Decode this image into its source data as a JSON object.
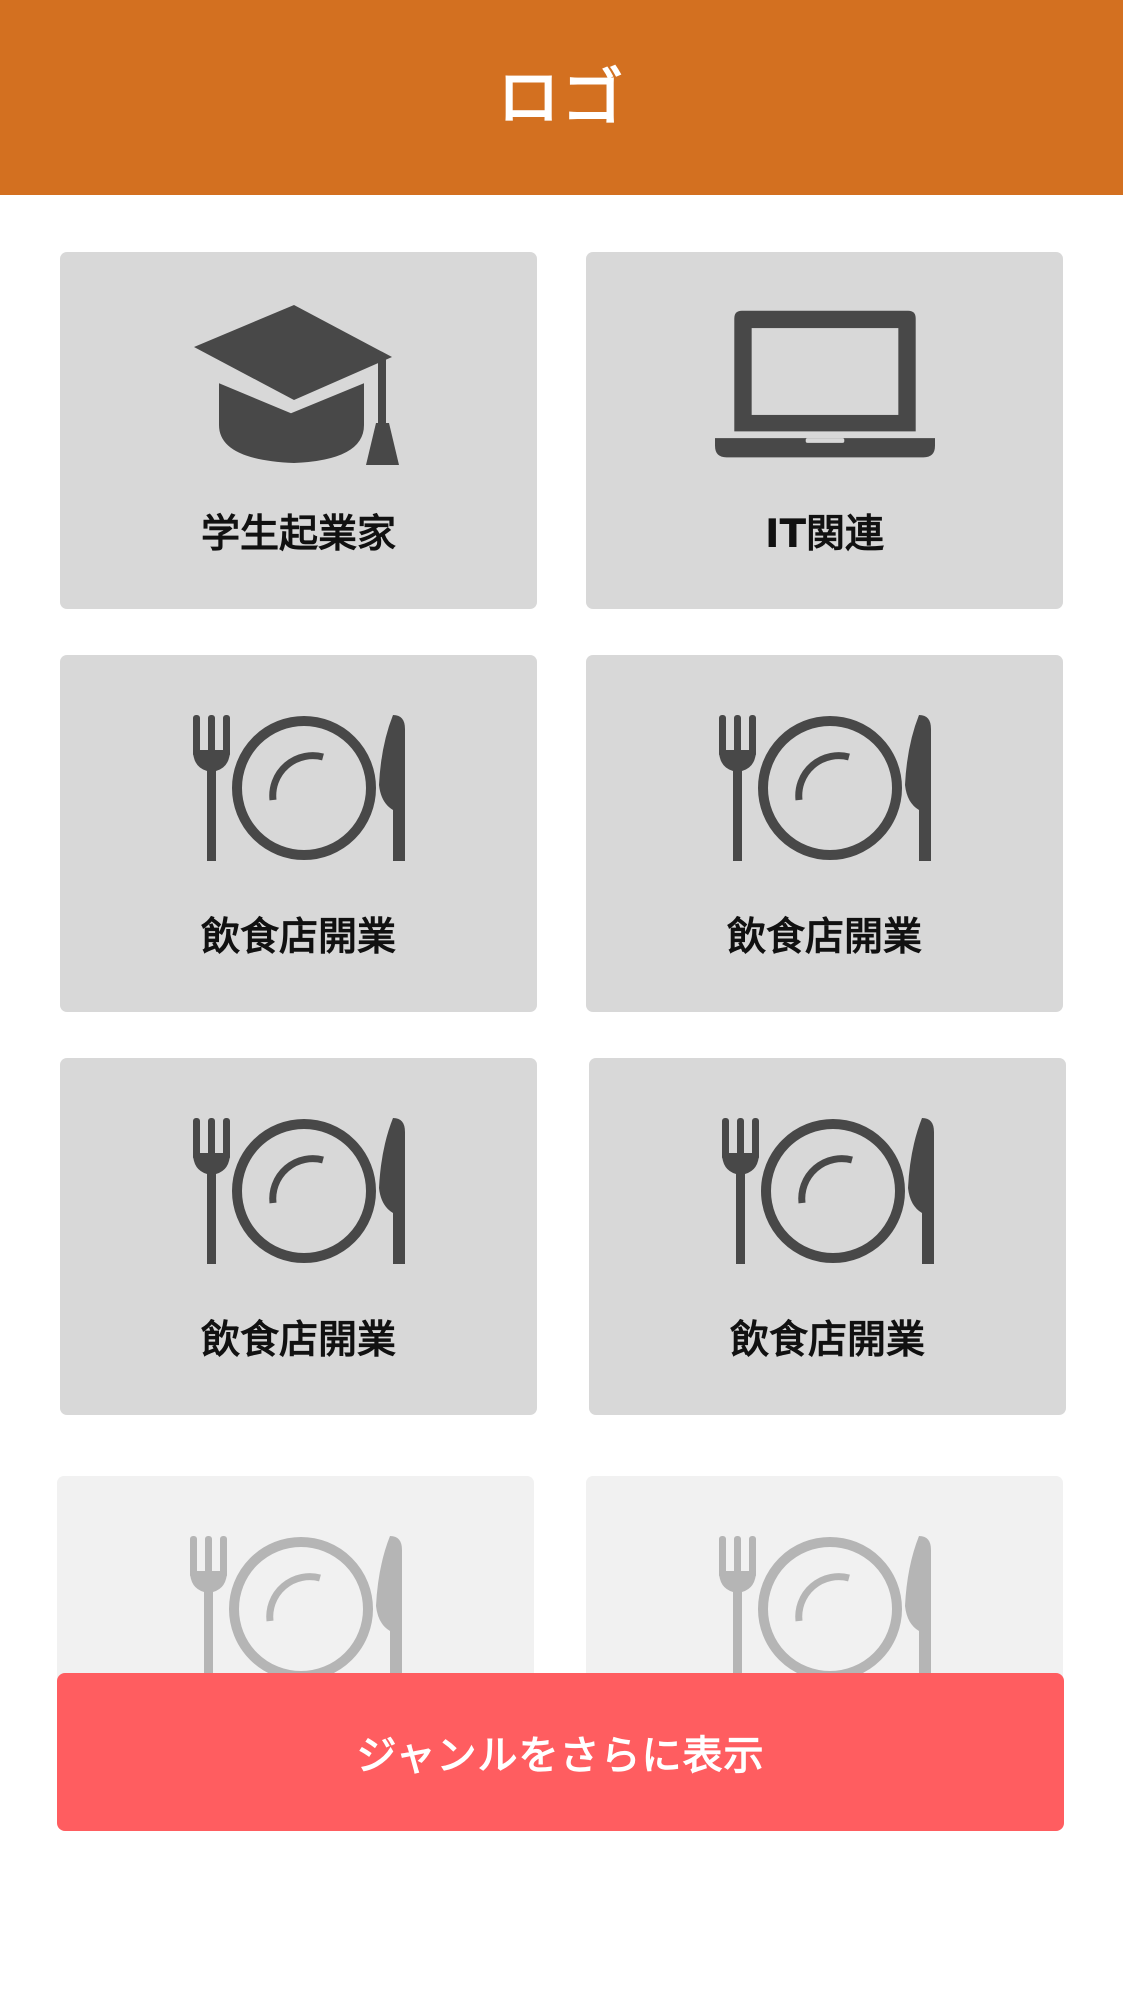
{
  "header": {
    "logo_text": "ロゴ"
  },
  "genres": [
    {
      "label": "学生起業家",
      "icon": "graduation-cap-icon"
    },
    {
      "label": "IT関連",
      "icon": "laptop-icon"
    },
    {
      "label": "飲食店開業",
      "icon": "restaurant-icon"
    },
    {
      "label": "飲食店開業",
      "icon": "restaurant-icon"
    },
    {
      "label": "飲食店開業",
      "icon": "restaurant-icon"
    },
    {
      "label": "飲食店開業",
      "icon": "restaurant-icon"
    },
    {
      "label": "",
      "icon": "restaurant-icon"
    },
    {
      "label": "",
      "icon": "restaurant-icon"
    }
  ],
  "more_button": {
    "label": "ジャンルをさらに表示"
  },
  "colors": {
    "header_bg": "#D37020",
    "card_bg": "#D8D8D8",
    "card_faded_bg": "#F1F1F1",
    "icon": "#484848",
    "icon_faded": "#B5B5B5",
    "button_bg": "#FF5D60"
  }
}
